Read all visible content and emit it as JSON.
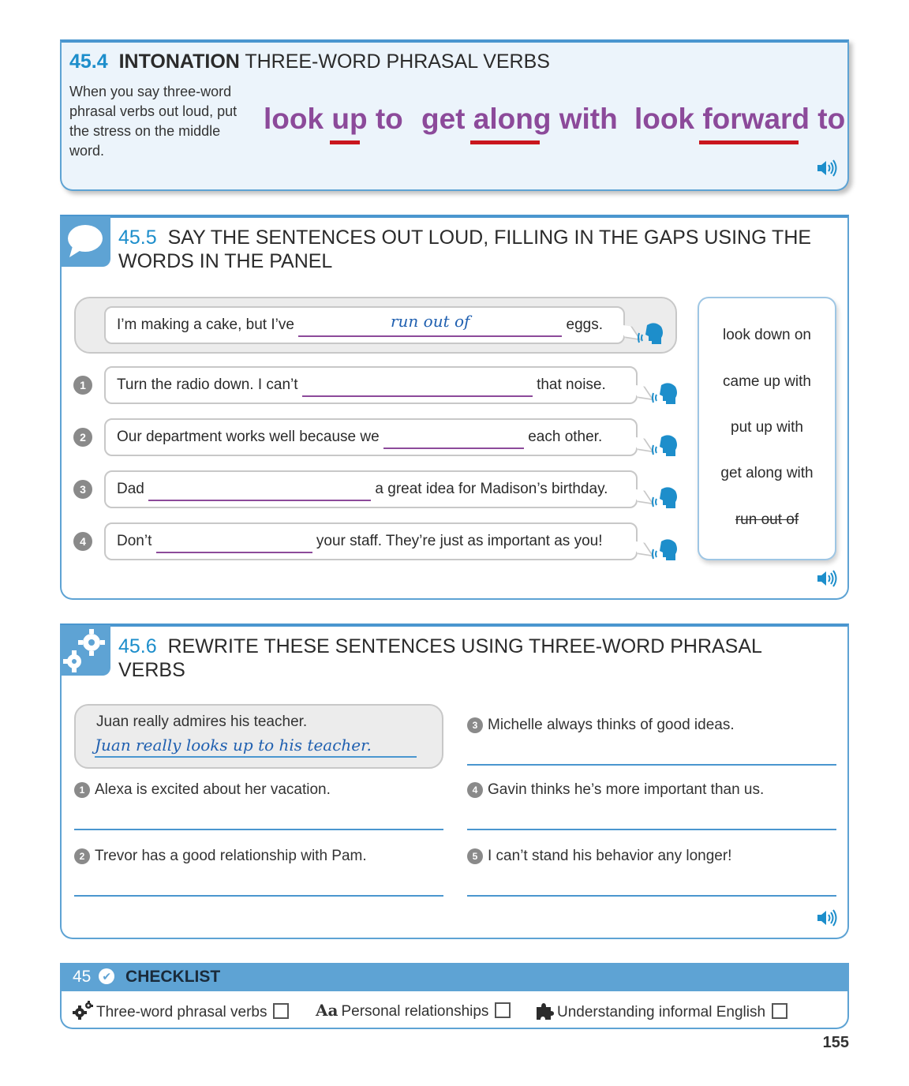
{
  "s454": {
    "num": "45.4",
    "title_bold": "INTONATION",
    "title_rest": "THREE-WORD PHRASAL VERBS",
    "description": "When you say three-word phrasal verbs out loud, put the stress on the middle word.",
    "phrases": [
      {
        "pre": "look ",
        "stress": "up",
        "post": " to"
      },
      {
        "pre": "get ",
        "stress": "along",
        "post": " with"
      },
      {
        "pre": "look ",
        "stress": "forward",
        "post": " to"
      }
    ]
  },
  "s455": {
    "num": "45.5",
    "title": "SAY THE SENTENCES OUT LOUD, FILLING IN THE GAPS USING THE WORDS IN THE PANEL",
    "example": {
      "pre": "I’m making a cake, but I’ve ",
      "answer": "run out of",
      "post": " eggs."
    },
    "items": [
      {
        "n": "1",
        "pre": "Turn the radio down. I can’t ",
        "post": " that noise."
      },
      {
        "n": "2",
        "pre": "Our department works well because we ",
        "post": " each other."
      },
      {
        "n": "3",
        "pre": "Dad ",
        "post": " a great idea for Madison’s birthday."
      },
      {
        "n": "4",
        "pre": "Don’t ",
        "post": " your staff. They’re just as important as you!"
      }
    ],
    "panel": [
      "look down on",
      "came up with",
      "put up with",
      "get along with",
      "run out of"
    ]
  },
  "s456": {
    "num": "45.6",
    "title": "REWRITE THESE SENTENCES USING THREE-WORD PHRASAL VERBS",
    "example": {
      "q": "Juan really admires his teacher.",
      "a": "Juan really looks up to his teacher."
    },
    "items": [
      {
        "n": "1",
        "text": "Alexa is excited about her vacation."
      },
      {
        "n": "2",
        "text": "Trevor has a good relationship with Pam."
      },
      {
        "n": "3",
        "text": "Michelle always thinks of good ideas."
      },
      {
        "n": "4",
        "text": "Gavin thinks he’s more important than us."
      },
      {
        "n": "5",
        "text": "I can’t stand his behavior any longer!"
      }
    ]
  },
  "checklist": {
    "num": "45",
    "title": "CHECKLIST",
    "items": [
      "Three-word phrasal verbs",
      "Personal relationships",
      "Understanding informal English"
    ],
    "aa": "Aa"
  },
  "page_number": "155"
}
